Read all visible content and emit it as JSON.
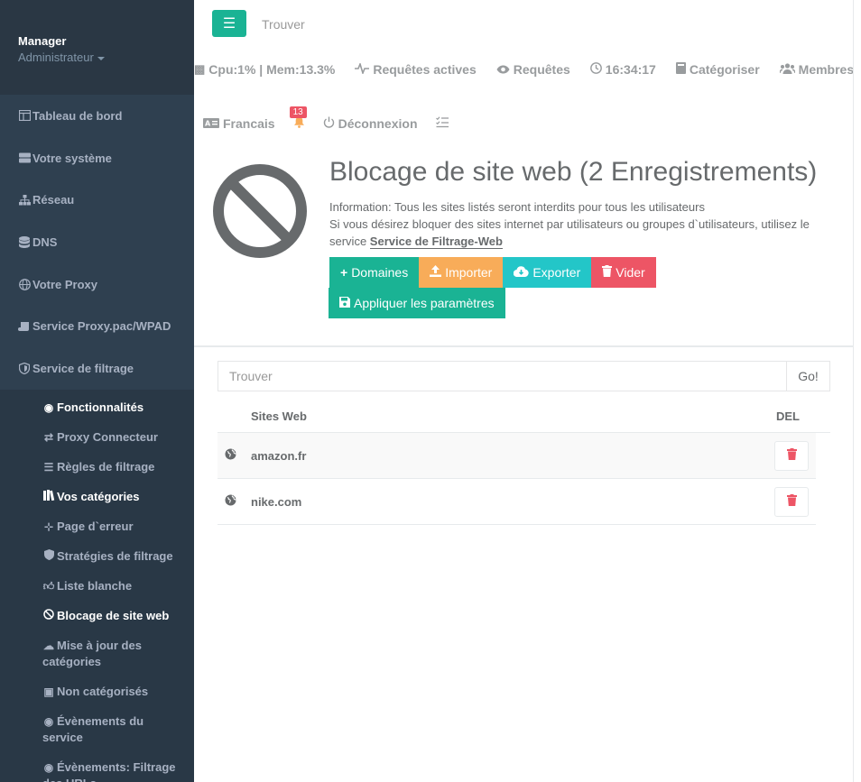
{
  "sidebar": {
    "profile": {
      "name": "Manager",
      "role": "Administrateur"
    },
    "items": [
      {
        "label": "Tableau de bord",
        "icon": "table-icon"
      },
      {
        "label": "Votre système",
        "icon": "server-icon"
      },
      {
        "label": "Réseau",
        "icon": "sitemap-icon"
      },
      {
        "label": "DNS",
        "icon": "database-icon"
      },
      {
        "label": "Votre Proxy",
        "icon": "globe-icon"
      },
      {
        "label": "Service Proxy.pac/WPAD",
        "icon": "scroll-icon"
      },
      {
        "label": "Service de filtrage",
        "icon": "shield-icon"
      }
    ],
    "submenu": [
      {
        "label": "Fonctionnalités",
        "icon": "dot-circle-icon"
      },
      {
        "label": "Proxy Connecteur",
        "icon": "exchange-icon"
      },
      {
        "label": "Règles de filtrage",
        "icon": "list-icon"
      },
      {
        "label": "Vos catégories",
        "icon": "books-icon"
      },
      {
        "label": "Page d`erreur",
        "icon": "network-icon"
      },
      {
        "label": "Stratégies de filtrage",
        "icon": "shield-icon"
      },
      {
        "label": "Liste blanche",
        "icon": "thumbs-up-icon"
      },
      {
        "label": "Blocage de site web",
        "icon": "ban-icon"
      },
      {
        "label": "Mise à jour des catégories",
        "icon": "cloud-download-icon"
      },
      {
        "label": "Non catégorisés",
        "icon": "file-search-icon"
      },
      {
        "label": "Évènements du service",
        "icon": "eye-icon"
      },
      {
        "label": "Évènements: Filtrage des URLs",
        "icon": "eye-icon"
      }
    ]
  },
  "topbar": {
    "search_label": "Trouver",
    "status": {
      "cpu_mem": "Cpu:1% | Mem:13.3%",
      "active_requests": "Requêtes actives",
      "requests": "Requêtes",
      "time": "16:34:17",
      "categorize": "Catégoriser",
      "members": "Membres",
      "language": "Francais",
      "notifications": "13",
      "logout": "Déconnexion"
    }
  },
  "header": {
    "title": "Blocage de site web (2 Enregistrements)",
    "info_line1": "Information: Tous les sites listés seront interdits pour tous les utilisateurs",
    "info_line2": "Si vous désirez bloquer des sites internet par utilisateurs ou groupes d`utilisateurs, utilisez le service ",
    "info_link": "Service de Filtrage-Web"
  },
  "buttons": {
    "domains": "Domaines",
    "import": "Importer",
    "export": "Exporter",
    "empty": "Vider",
    "apply": "Appliquer les paramètres"
  },
  "search": {
    "placeholder": "Trouver",
    "go": "Go!"
  },
  "table": {
    "headers": {
      "site": "Sites Web",
      "del": "DEL"
    },
    "rows": [
      {
        "site": "amazon.fr"
      },
      {
        "site": "nike.com"
      }
    ]
  },
  "colors": {
    "sidebar": "#2f4050",
    "green": "#1ab394",
    "orange": "#f8ac59",
    "cyan": "#23c6c8",
    "red": "#ed5565"
  }
}
